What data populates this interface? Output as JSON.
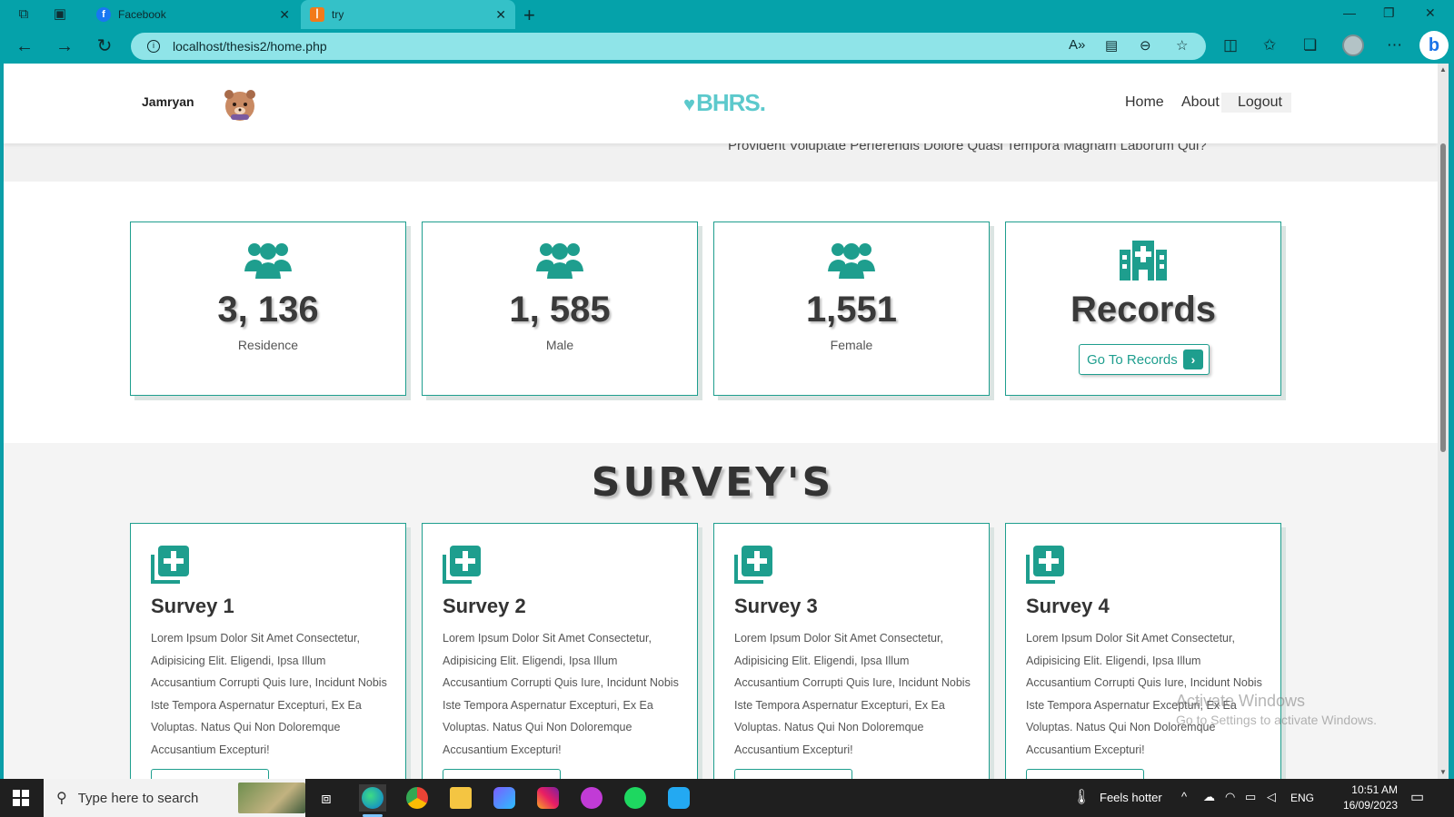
{
  "browser": {
    "tabs": [
      {
        "title": "Facebook",
        "favicon": "facebook-icon"
      },
      {
        "title": "try",
        "favicon": "xampp-icon"
      }
    ],
    "url": "localhost/thesis2/home.php"
  },
  "header": {
    "username": "Jamryan",
    "logo_text": "BHRS.",
    "nav": [
      "Home",
      "About",
      "Logout"
    ]
  },
  "hero": {
    "text": "Provident Voluptate Perferendis Dolore Quasi Tempora Magnam Laborum Qui?"
  },
  "stats": [
    {
      "value": "3, 136",
      "label": "Residence",
      "icon": "users-icon"
    },
    {
      "value": "1, 585",
      "label": "Male",
      "icon": "users-icon"
    },
    {
      "value": "1,551",
      "label": "Female",
      "icon": "users-icon"
    },
    {
      "value": "Records",
      "label": "",
      "icon": "hospital-icon",
      "button": "Go To Records"
    }
  ],
  "surveys": {
    "heading": "SURVEY'S",
    "cards": [
      {
        "title": "Survey 1",
        "description": "Lorem Ipsum Dolor Sit Amet Consectetur, Adipisicing Elit. Eligendi, Ipsa Illum Accusantium Corrupti Quis Iure, Incidunt Nobis Iste Tempora Aspernatur Excepturi, Ex Ea Voluptas. Natus Qui Non Doloremque Accusantium Excepturi!"
      },
      {
        "title": "Survey 2",
        "description": "Lorem Ipsum Dolor Sit Amet Consectetur, Adipisicing Elit. Eligendi, Ipsa Illum Accusantium Corrupti Quis Iure, Incidunt Nobis Iste Tempora Aspernatur Excepturi, Ex Ea Voluptas. Natus Qui Non Doloremque Accusantium Excepturi!"
      },
      {
        "title": "Survey 3",
        "description": "Lorem Ipsum Dolor Sit Amet Consectetur, Adipisicing Elit. Eligendi, Ipsa Illum Accusantium Corrupti Quis Iure, Incidunt Nobis Iste Tempora Aspernatur Excepturi, Ex Ea Voluptas. Natus Qui Non Doloremque Accusantium Excepturi!"
      },
      {
        "title": "Survey 4",
        "description": "Lorem Ipsum Dolor Sit Amet Consectetur, Adipisicing Elit. Eligendi, Ipsa Illum Accusantium Corrupti Quis Iure, Incidunt Nobis Iste Tempora Aspernatur Excepturi, Ex Ea Voluptas. Natus Qui Non Doloremque Accusantium Excepturi!"
      }
    ]
  },
  "watermark": {
    "line1": "Activate Windows",
    "line2": "Go to Settings to activate Windows."
  },
  "taskbar": {
    "search_placeholder": "Type here to search",
    "weather": "Feels hotter",
    "language": "ENG",
    "time": "10:51 AM",
    "date": "16/09/2023"
  },
  "colors": {
    "accent": "#1e9e8e",
    "browser_chrome": "#05a2aa",
    "address_bar": "#8fe4e8"
  }
}
